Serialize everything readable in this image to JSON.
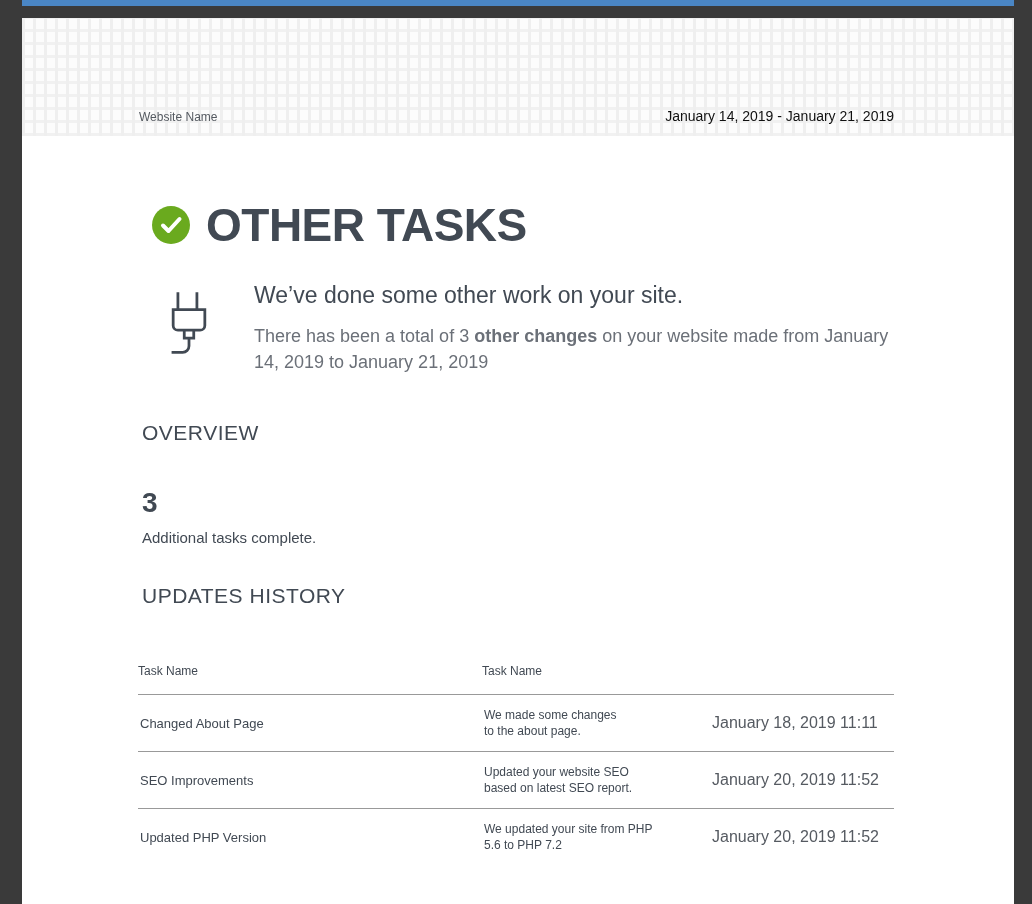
{
  "header": {
    "site_name": "Website Name",
    "date_range": "January 14, 2019 - January 21, 2019"
  },
  "section": {
    "title": "OTHER TASKS",
    "headline": "We’ve done some other work on your site.",
    "description": "There has been a total of 3 **other changes** on your website made from January 14, 2019 to January 21, 2019"
  },
  "overview": {
    "heading": "OVERVIEW",
    "count": "3",
    "caption": "Additional tasks complete."
  },
  "history": {
    "heading": "UPDATES HISTORY",
    "columns": [
      "Task Name",
      "Task Name"
    ],
    "rows": [
      {
        "name": "Changed About Page",
        "details": "We made some changes\nto the about page.",
        "date": "January 18, 2019 11:11"
      },
      {
        "name": "SEO Improvements",
        "details": "Updated your website SEO\nbased on latest SEO report.",
        "date": "January 20, 2019 11:52"
      },
      {
        "name": "Updated PHP Version",
        "details": "We updated your site from PHP\n5.6 to PHP 7.2",
        "date": "January 20, 2019 11:52"
      }
    ]
  }
}
